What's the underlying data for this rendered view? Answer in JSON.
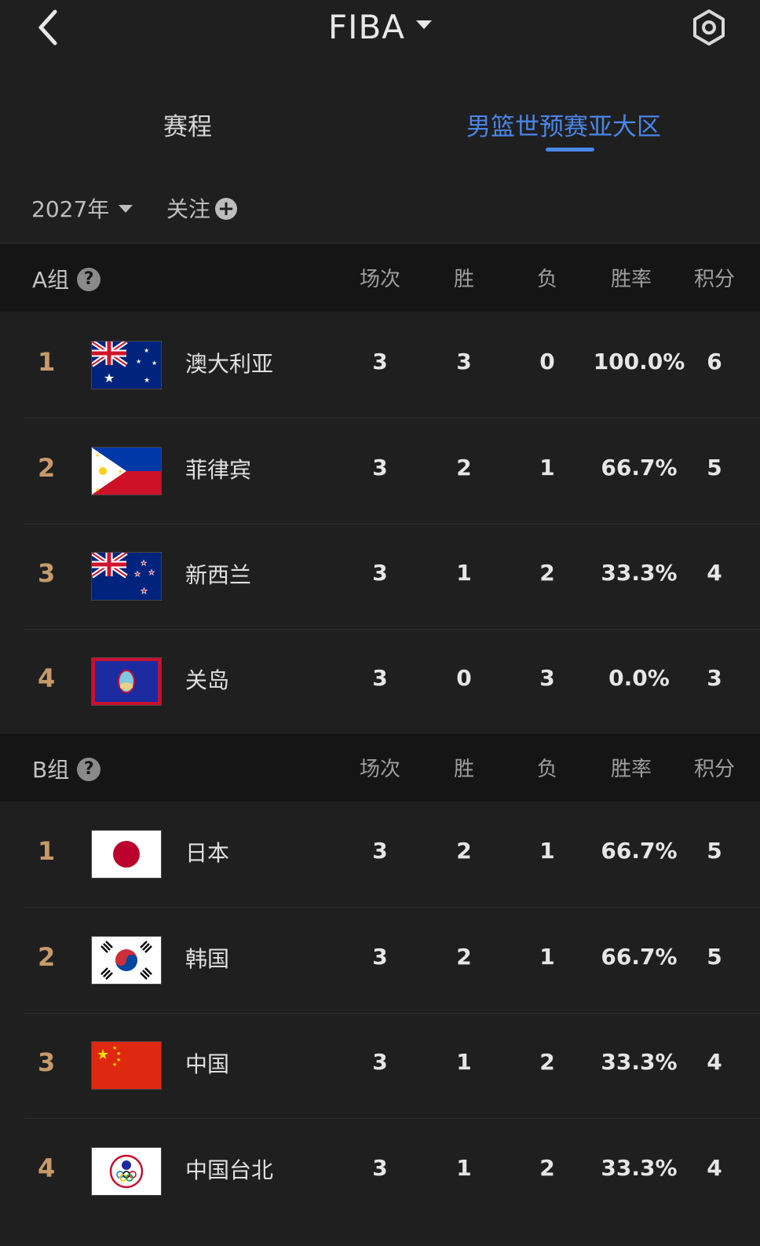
{
  "header": {
    "title": "FIBA"
  },
  "tabs": {
    "schedule": "赛程",
    "league": "男篮世预赛亚大区"
  },
  "filters": {
    "year": "2027年",
    "follow": "关注",
    "plus": "+"
  },
  "columns": {
    "played": "场次",
    "won": "胜",
    "lost": "负",
    "win_pct": "胜率",
    "points": "积分"
  },
  "groups": [
    {
      "title": "A组",
      "help": "?",
      "rows": [
        {
          "rank": "1",
          "flag": "australia-flag-icon",
          "team": "澳大利亚",
          "played": "3",
          "won": "3",
          "lost": "0",
          "win_pct": "100.0%",
          "points": "6"
        },
        {
          "rank": "2",
          "flag": "philippines-flag-icon",
          "team": "菲律宾",
          "played": "3",
          "won": "2",
          "lost": "1",
          "win_pct": "66.7%",
          "points": "5"
        },
        {
          "rank": "3",
          "flag": "new-zealand-flag-icon",
          "team": "新西兰",
          "played": "3",
          "won": "1",
          "lost": "2",
          "win_pct": "33.3%",
          "points": "4"
        },
        {
          "rank": "4",
          "flag": "guam-flag-icon",
          "team": "关岛",
          "played": "3",
          "won": "0",
          "lost": "3",
          "win_pct": "0.0%",
          "points": "3"
        }
      ]
    },
    {
      "title": "B组",
      "help": "?",
      "rows": [
        {
          "rank": "1",
          "flag": "japan-flag-icon",
          "team": "日本",
          "played": "3",
          "won": "2",
          "lost": "1",
          "win_pct": "66.7%",
          "points": "5"
        },
        {
          "rank": "2",
          "flag": "korea-flag-icon",
          "team": "韩国",
          "played": "3",
          "won": "2",
          "lost": "1",
          "win_pct": "66.7%",
          "points": "5"
        },
        {
          "rank": "3",
          "flag": "china-flag-icon",
          "team": "中国",
          "played": "3",
          "won": "1",
          "lost": "2",
          "win_pct": "33.3%",
          "points": "4"
        },
        {
          "rank": "4",
          "flag": "chinese-taipei-flag-icon",
          "team": "中国台北",
          "played": "3",
          "won": "1",
          "lost": "2",
          "win_pct": "33.3%",
          "points": "4"
        }
      ]
    }
  ],
  "colors": {
    "accent": "#4a86e8",
    "rank": "#c79a6a",
    "background": "#1f1f20",
    "header_bg": "#151515"
  }
}
